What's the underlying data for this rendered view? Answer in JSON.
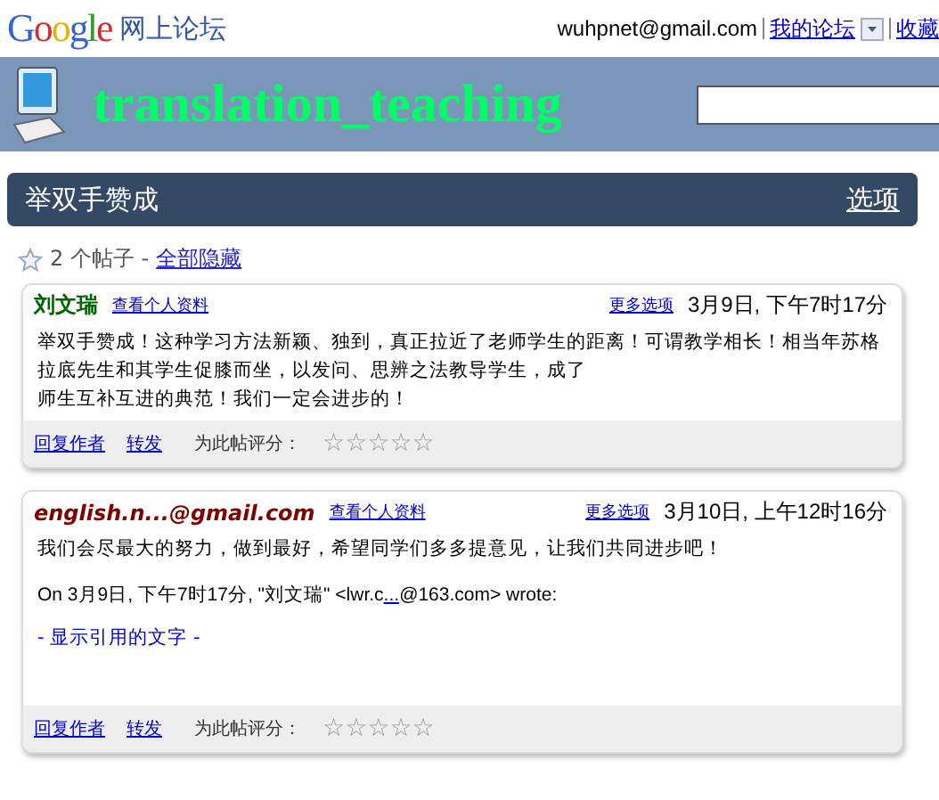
{
  "header": {
    "logo": "Google",
    "product": "网上论坛",
    "account": "wuhpnet@gmail.com",
    "links": [
      "我的论坛",
      "收藏"
    ]
  },
  "group": {
    "name": "translation_teaching"
  },
  "topic": {
    "title": "举双手赞成",
    "options": "选项",
    "starred": false,
    "count": "2 个帖子 -",
    "toggle": "全部隐藏"
  },
  "posts": [
    {
      "author": "刘文瑞",
      "color": "#006600",
      "profile": "查看个人资料",
      "more": "更多选项",
      "date": "3月9日, 下午7时17分",
      "body": [
        "举双手赞成！这种学习方法新颖、独到，真正拉近了老师学生的距离！可谓教学相长！相当年苏格拉底先生和其学生促膝而坐，以发问、思辨之法教导学生，成了",
        "师生互补互进的典范！我们一定会进步的！"
      ],
      "reply": "回复作者",
      "forward": "转发",
      "rate_label": "为此帖评分：",
      "stars": 0
    },
    {
      "author": "english.n...@gmail.com",
      "color": "#800000",
      "profile": "查看个人资料",
      "more": "更多选项",
      "date": "3月10日, 上午12时16分",
      "body": [
        "我们会尽最大的努力，做到最好，希望同学们多多提意见，让我们共同进步吧！"
      ],
      "attribution": {
        "before": "On 3月9日, 下午7时17分, \"刘文瑞\" <lwr.c",
        "link": "...",
        "after": "@163.com> wrote:"
      },
      "quote_toggle": "- 显示引用的文字 -",
      "reply": "回复作者",
      "forward": "转发",
      "rate_label": "为此帖评分：",
      "stars": 0
    }
  ]
}
